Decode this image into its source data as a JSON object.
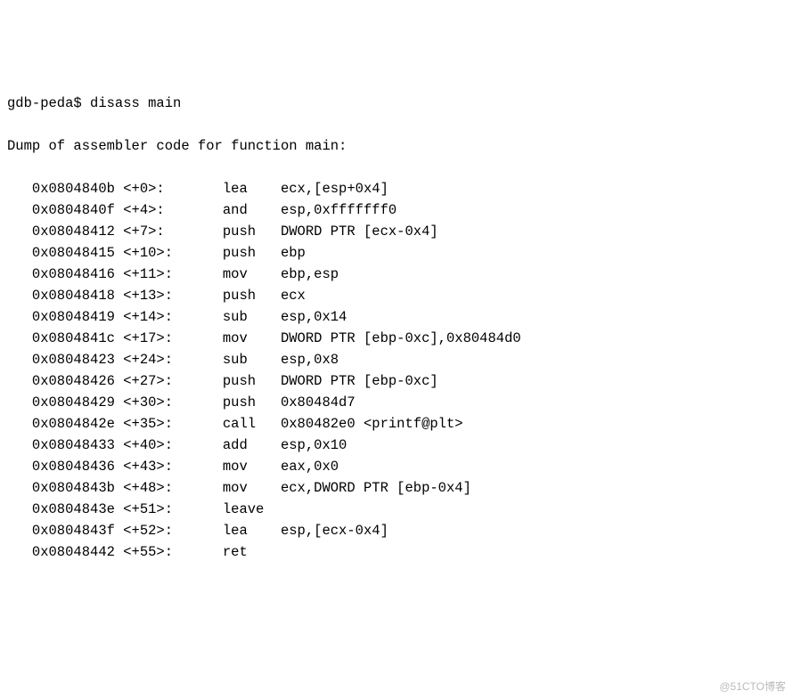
{
  "prompt_line": "gdb-peda$ disass main",
  "header_line": "Dump of assembler code for function main:",
  "rows": [
    {
      "addr": "0x0804840b",
      "off": "<+0>:",
      "mn": "lea",
      "ops": "ecx,[esp+0x4]"
    },
    {
      "addr": "0x0804840f",
      "off": "<+4>:",
      "mn": "and",
      "ops": "esp,0xfffffff0"
    },
    {
      "addr": "0x08048412",
      "off": "<+7>:",
      "mn": "push",
      "ops": "DWORD PTR [ecx-0x4]"
    },
    {
      "addr": "0x08048415",
      "off": "<+10>:",
      "mn": "push",
      "ops": "ebp"
    },
    {
      "addr": "0x08048416",
      "off": "<+11>:",
      "mn": "mov",
      "ops": "ebp,esp"
    },
    {
      "addr": "0x08048418",
      "off": "<+13>:",
      "mn": "push",
      "ops": "ecx"
    },
    {
      "addr": "0x08048419",
      "off": "<+14>:",
      "mn": "sub",
      "ops": "esp,0x14"
    },
    {
      "addr": "0x0804841c",
      "off": "<+17>:",
      "mn": "mov",
      "ops": "DWORD PTR [ebp-0xc],0x80484d0"
    },
    {
      "addr": "0x08048423",
      "off": "<+24>:",
      "mn": "sub",
      "ops": "esp,0x8"
    },
    {
      "addr": "0x08048426",
      "off": "<+27>:",
      "mn": "push",
      "ops": "DWORD PTR [ebp-0xc]"
    },
    {
      "addr": "0x08048429",
      "off": "<+30>:",
      "mn": "push",
      "ops": "0x80484d7"
    },
    {
      "addr": "0x0804842e",
      "off": "<+35>:",
      "mn": "call",
      "ops": "0x80482e0 <printf@plt>"
    },
    {
      "addr": "0x08048433",
      "off": "<+40>:",
      "mn": "add",
      "ops": "esp,0x10"
    },
    {
      "addr": "0x08048436",
      "off": "<+43>:",
      "mn": "mov",
      "ops": "eax,0x0"
    },
    {
      "addr": "0x0804843b",
      "off": "<+48>:",
      "mn": "mov",
      "ops": "ecx,DWORD PTR [ebp-0x4]"
    },
    {
      "addr": "0x0804843e",
      "off": "<+51>:",
      "mn": "leave",
      "ops": ""
    },
    {
      "addr": "0x0804843f",
      "off": "<+52>:",
      "mn": "lea",
      "ops": "esp,[ecx-0x4]"
    },
    {
      "addr": "0x08048442",
      "off": "<+55>:",
      "mn": "ret",
      "ops": ""
    }
  ],
  "watermark": "@51CTO博客"
}
